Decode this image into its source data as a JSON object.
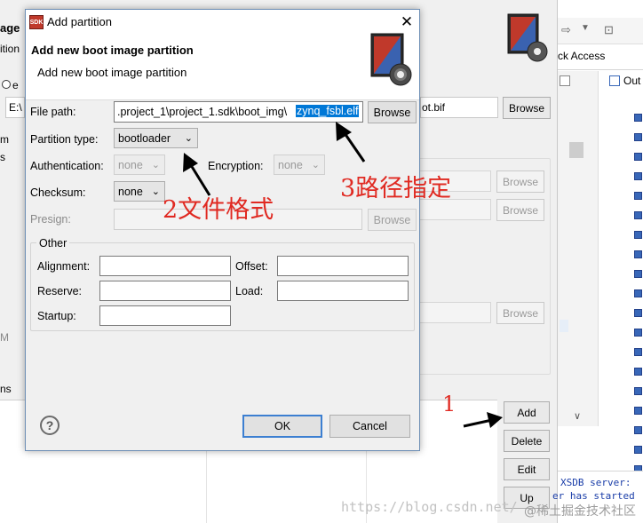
{
  "background": {
    "frag_top_right": "ck Access",
    "frag_outline": "Out",
    "frag_image": "age",
    "frag_ition": "ition",
    "frag_e": "e",
    "frag_ex": "E:\\",
    "frag_bif": "ot.bif",
    "frag_m": "m",
    "frag_s": "s",
    "frag_mm": "M",
    "frag_ns": "ns",
    "browse": "Browse",
    "console_line1": "XSDB server: ",
    "console_line2": "er has started",
    "side_buttons": {
      "add": "Add",
      "delete": "Delete",
      "edit": "Edit",
      "up": "Up"
    }
  },
  "dialog": {
    "title": "Add partition",
    "sdk_icon_text": "SDK",
    "heading": "Add new boot image partition",
    "subheading": "Add new boot image partition",
    "file_path_label": "File path:",
    "file_path_value_plain": ".project_1\\project_1.sdk\\boot_img\\",
    "file_path_value_selected": "zynq_fsbl.elf",
    "browse": "Browse",
    "partition_type_label": "Partition type:",
    "partition_type_value": "bootloader",
    "authentication_label": "Authentication:",
    "authentication_value": "none",
    "encryption_label": "Encryption:",
    "encryption_value": "none",
    "checksum_label": "Checksum:",
    "checksum_value": "none",
    "presign_label": "Presign:",
    "other_group": "Other",
    "alignment_label": "Alignment:",
    "offset_label": "Offset:",
    "reserve_label": "Reserve:",
    "load_label": "Load:",
    "startup_label": "Startup:",
    "help": "?",
    "ok": "OK",
    "cancel": "Cancel"
  },
  "annotations": {
    "step1": "1",
    "step2": "2文件格式",
    "step3": "3路径指定"
  },
  "watermark": {
    "url": "https://blog.csdn.net/",
    "brand": "@稀土掘金技术社区"
  }
}
